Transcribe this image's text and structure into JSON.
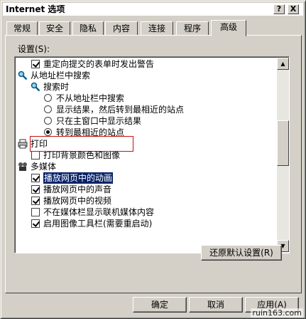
{
  "window": {
    "title": "Internet 选项",
    "help_button": "?",
    "close_button": "X"
  },
  "tabs": [
    {
      "label": "常规",
      "active": false
    },
    {
      "label": "安全",
      "active": false
    },
    {
      "label": "隐私",
      "active": false
    },
    {
      "label": "内容",
      "active": false
    },
    {
      "label": "连接",
      "active": false
    },
    {
      "label": "程序",
      "active": false
    },
    {
      "label": "高级",
      "active": true
    }
  ],
  "settings": {
    "label": "设置(S):",
    "items": [
      {
        "type": "checkbox",
        "checked": true,
        "label": "重定向提交的表单时发出警告"
      },
      {
        "type": "group",
        "icon": "search-icon",
        "label": "从地址栏中搜索"
      },
      {
        "type": "group",
        "icon": "search-icon",
        "label": "搜索时"
      },
      {
        "type": "radio",
        "checked": false,
        "label": "不从地址栏中搜索"
      },
      {
        "type": "radio",
        "checked": false,
        "label": "显示结果，然后转到最相近的站点"
      },
      {
        "type": "radio",
        "checked": false,
        "label": "只在主窗口中显示结果"
      },
      {
        "type": "radio",
        "checked": true,
        "label": "转到最相近的站点"
      },
      {
        "type": "group",
        "icon": "printer-icon",
        "label": "打印"
      },
      {
        "type": "checkbox",
        "checked": false,
        "label": "打印背景颜色和图像"
      },
      {
        "type": "group",
        "icon": "multimedia-icon",
        "label": "多媒体"
      },
      {
        "type": "checkbox",
        "checked": true,
        "label": "播放网页中的动画",
        "highlighted": true
      },
      {
        "type": "checkbox",
        "checked": true,
        "label": "播放网页中的声音"
      },
      {
        "type": "checkbox",
        "checked": true,
        "label": "播放网页中的视频"
      },
      {
        "type": "checkbox",
        "checked": false,
        "label": "不在媒体栏显示联机媒体内容"
      },
      {
        "type": "checkbox",
        "checked": true,
        "label": "启用图像工具栏(需要重启动)"
      }
    ]
  },
  "buttons": {
    "restore_defaults": "还原默认设置(R)",
    "ok": "确定",
    "cancel": "取消",
    "apply": "应用(A)"
  },
  "watermark": "ruin163.com",
  "colors": {
    "dialog_face": "#d4d0c8",
    "selection": "#0a246a",
    "annotation_box": "#c81010"
  }
}
